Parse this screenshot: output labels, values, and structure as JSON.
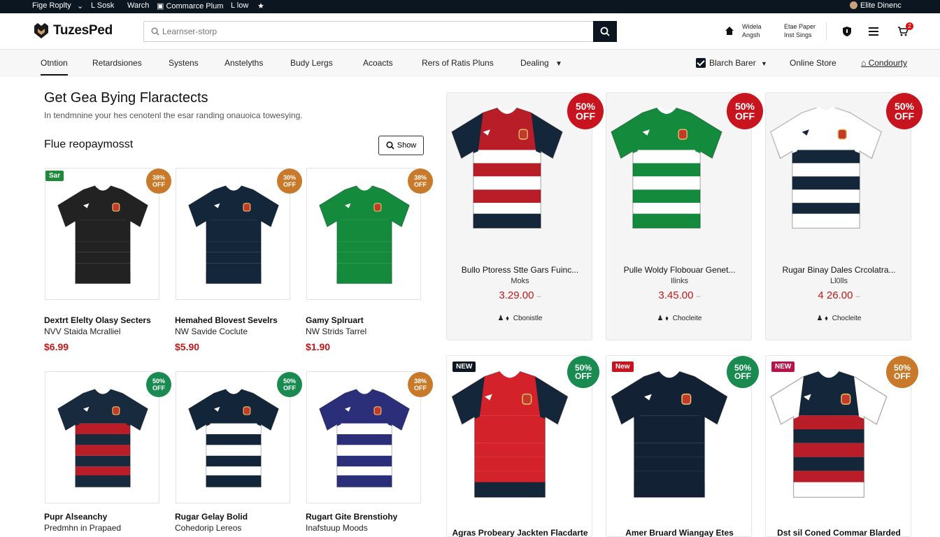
{
  "topbar": {
    "items": [
      "Fige Roplty",
      "L Sosk",
      "Warch",
      "Commarce Plum",
      "L low"
    ],
    "account": "Elite Dinenc"
  },
  "header": {
    "logo": "TuzesPed",
    "search_placeholder": "Learnser-storp",
    "account_line1": "Widela",
    "account_line2": "Angsh",
    "orders_line1": "Etae Paper",
    "orders_line2": "Inst Sings",
    "cart_count": "2"
  },
  "nav": {
    "items": [
      "Otntion",
      "Retardsiones",
      "Systens",
      "Anstelyths",
      "Budy Lergs",
      "Acoacts",
      "Rers of Ratis Pluns",
      "Dealing"
    ],
    "filter_label": "Blarch Barer",
    "online_store": "Online Store",
    "condourty": "Condourty"
  },
  "section": {
    "title": "Get Gea Bying Flaractects",
    "subtitle": "In tendmnine your hes cenotenl the esar randing onauoica towesying.",
    "subheading": "Flue reopaymosst",
    "show_button": "Show"
  },
  "small_products": [
    {
      "name": "Dextrt Elelty Olasy Secters",
      "brand": "NVV Staida Mcralliel",
      "price": "$6.99",
      "discount": [
        "38%",
        "OFF"
      ],
      "disc_color": "#c87a2a",
      "tag": "Sar",
      "tag_color": "#1f8a3a",
      "colors": [
        "#222",
        "#222",
        "#222"
      ]
    },
    {
      "name": "Hemahed Blovest Sevelrs",
      "brand": "NW Savide Coclute",
      "price": "$5.90",
      "discount": [
        "30%",
        "OFF"
      ],
      "disc_color": "#c87a2a",
      "colors": [
        "#14263a",
        "#14263a",
        "#14263a"
      ]
    },
    {
      "name": "Gamy Splruart",
      "brand": "NW Strids Tarrel",
      "price": "$1.90",
      "discount": [
        "38%",
        "OFF"
      ],
      "disc_color": "#c87a2a",
      "colors": [
        "#138a3c",
        "#138a3c",
        "#138a3c"
      ]
    },
    {
      "name": "Pupr Alseanchy",
      "brand": "Predmhn in Prapaed",
      "discount": [
        "50%",
        "OFF"
      ],
      "disc_color": "#198a50",
      "colors": [
        "#172a3e",
        "#b81d28",
        "#172a3e"
      ]
    },
    {
      "name": "Rugar Gelay Bolid",
      "brand": "Cohedorip Lereos",
      "discount": [
        "50%",
        "OFF"
      ],
      "disc_color": "#198a50",
      "colors": [
        "#132538",
        "#ffffff",
        "#132538"
      ]
    },
    {
      "name": "Rugart Gite Brenstiohy",
      "brand": "Inafstuup Moods",
      "discount": [
        "38%",
        "OFF"
      ],
      "disc_color": "#c87a2a",
      "colors": [
        "#2b2f7a",
        "#ffffff",
        "#2b2f7a"
      ]
    }
  ],
  "featured": [
    {
      "name": "Bullo Ptoress Stte Gars Fuinc...",
      "sub": "Moks",
      "price": "3.29.00",
      "option": "Cbonistle",
      "discount": [
        "50%",
        "OFF"
      ],
      "colors": [
        "#b81d28",
        "#ffffff",
        "#14263a"
      ]
    },
    {
      "name": "Pulle Woldy Flobouar Genet...",
      "sub": "Ilinks",
      "price": "3.45.00",
      "option": "Chocleite",
      "discount": [
        "50%",
        "OFF"
      ],
      "colors": [
        "#138a3c",
        "#ffffff",
        "#138a3c"
      ]
    },
    {
      "name": "Rugar Binay Dales Crcolatra...",
      "sub": "Ll0lls",
      "price": "4 26.00",
      "option": "Chocleite",
      "discount": [
        "50%",
        "OFF"
      ],
      "colors": [
        "#ffffff",
        "#14263a",
        "#ffffff"
      ]
    }
  ],
  "new_products": [
    {
      "tag": "NEW",
      "tag_color": "#0b1620",
      "name": "Agras Probeary Jackten Flacdarte",
      "discount": [
        "50%",
        "OFF"
      ],
      "disc_color": "#198a50",
      "colors": [
        "#d4222b",
        "#d4222b",
        "#14263a"
      ]
    },
    {
      "tag": "New",
      "tag_color": "#c8141e",
      "name": "Amer Bruard Wiangay Etes",
      "discount": [
        "50%",
        "OFF"
      ],
      "disc_color": "#198a50",
      "colors": [
        "#122234",
        "#122234",
        "#122234"
      ]
    },
    {
      "tag": "NEW",
      "tag_color": "#b8144a",
      "name": "Dst sil Coned Commar Blarded",
      "discount": [
        "50%",
        "OFF"
      ],
      "disc_color": "#c87a2a",
      "colors": [
        "#14263a",
        "#b81d28",
        "#ffffff"
      ]
    }
  ],
  "icons": {
    "search": "search-icon",
    "home": "home-icon",
    "shield": "shield-icon",
    "menu": "menu-icon",
    "cart": "cart-icon",
    "star": "star-icon",
    "chevron": "chevron-down-icon"
  }
}
